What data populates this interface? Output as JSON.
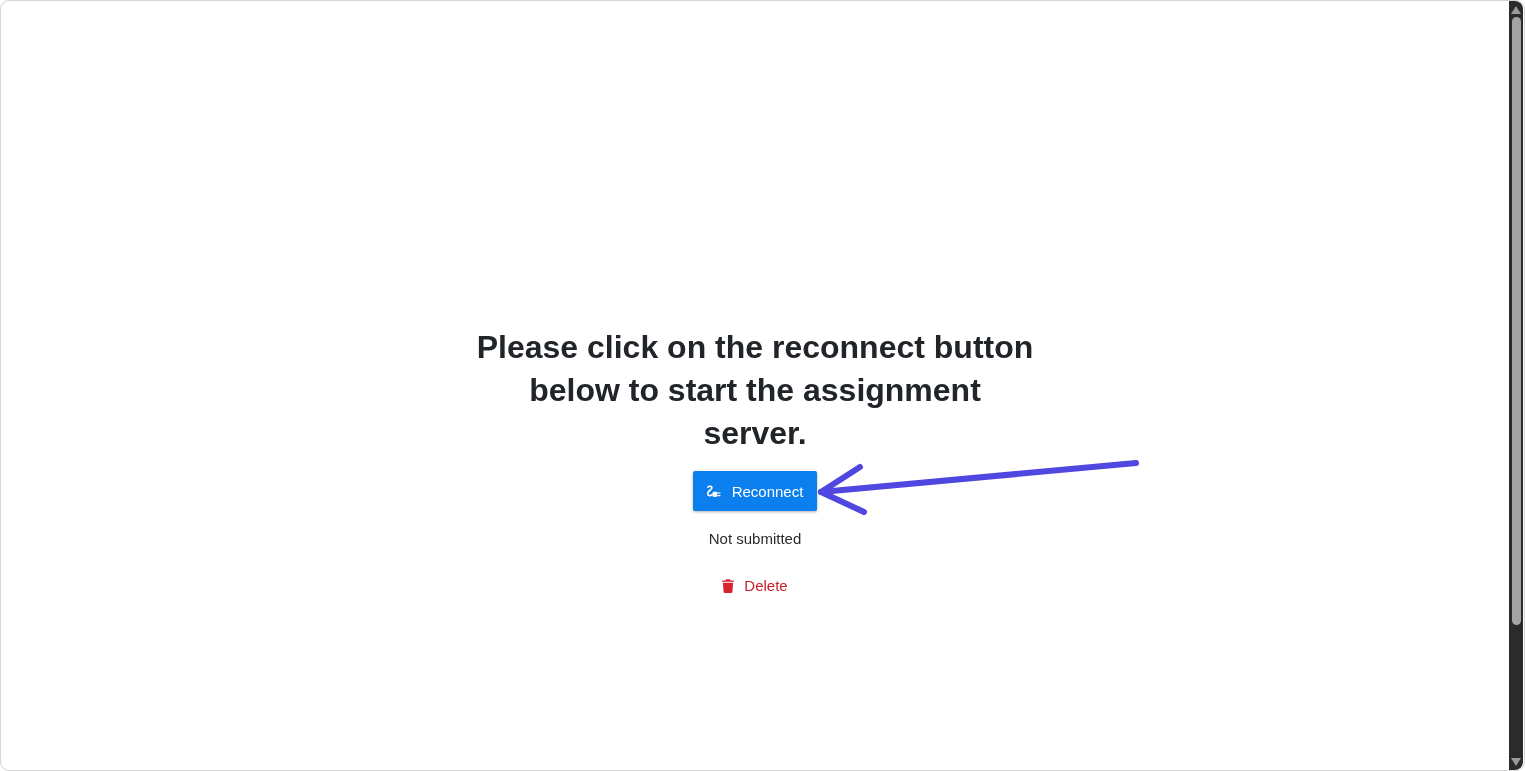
{
  "heading": "Please click on the reconnect button below to start the assignment server.",
  "reconnect_button": {
    "label": "Reconnect"
  },
  "status": "Not submitted",
  "delete_button": {
    "label": "Delete"
  }
}
